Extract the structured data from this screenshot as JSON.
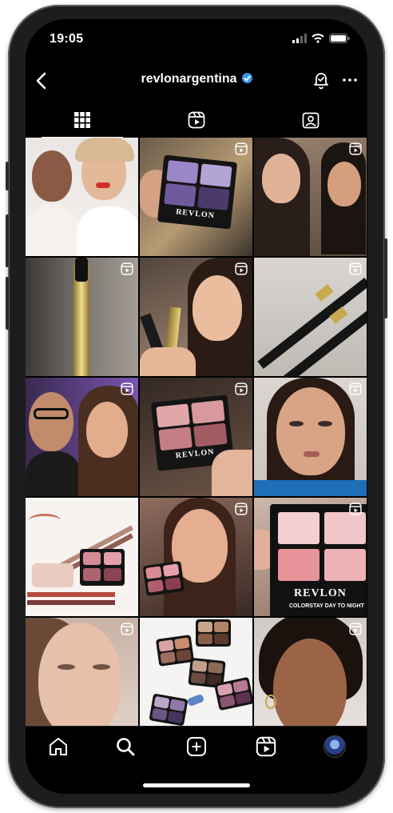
{
  "status_bar": {
    "time": "19:05"
  },
  "header": {
    "username": "revlonargentina",
    "verified": true
  },
  "tabs": [
    {
      "name": "posts",
      "icon": "grid-icon",
      "active": true
    },
    {
      "name": "reels",
      "icon": "reels-icon",
      "active": false
    },
    {
      "name": "tagged",
      "icon": "tagged-icon",
      "active": false
    }
  ],
  "posts": [
    {
      "desc": "two models with bold makeup",
      "reel": false
    },
    {
      "desc": "hand holding purple eyeshadow palette",
      "reel": true,
      "brand": "REVLON"
    },
    {
      "desc": "two women makeup tutorial",
      "reel": true
    },
    {
      "desc": "gold mascara tube",
      "reel": true
    },
    {
      "desc": "woman holding mascara",
      "reel": true
    },
    {
      "desc": "two mascara wands",
      "reel": true
    },
    {
      "desc": "man and woman selfie",
      "reel": true
    },
    {
      "desc": "pink eyeshadow palette close up",
      "reel": true,
      "brand": "REVLON"
    },
    {
      "desc": "woman with smoky eye",
      "reel": true
    },
    {
      "desc": "product flat lay with lip liners",
      "reel": false
    },
    {
      "desc": "woman holding pink palette",
      "reel": true
    },
    {
      "desc": "pink eyeshadow palette",
      "reel": true,
      "brand": "REVLON",
      "subtitle": "COLORSTAY DAY TO NIGHT"
    },
    {
      "desc": "woman natural makeup",
      "reel": true
    },
    {
      "desc": "multiple eyeshadow palettes",
      "reel": false
    },
    {
      "desc": "woman with curly hair",
      "reel": true
    }
  ],
  "bottom_nav": [
    {
      "name": "home",
      "icon": "home-icon"
    },
    {
      "name": "search",
      "icon": "search-icon"
    },
    {
      "name": "create",
      "icon": "plus-square-icon"
    },
    {
      "name": "reels",
      "icon": "reels-icon"
    },
    {
      "name": "profile",
      "icon": "avatar"
    }
  ],
  "colors": {
    "background": "#000000",
    "verified": "#3797f0",
    "text": "#ffffff"
  }
}
